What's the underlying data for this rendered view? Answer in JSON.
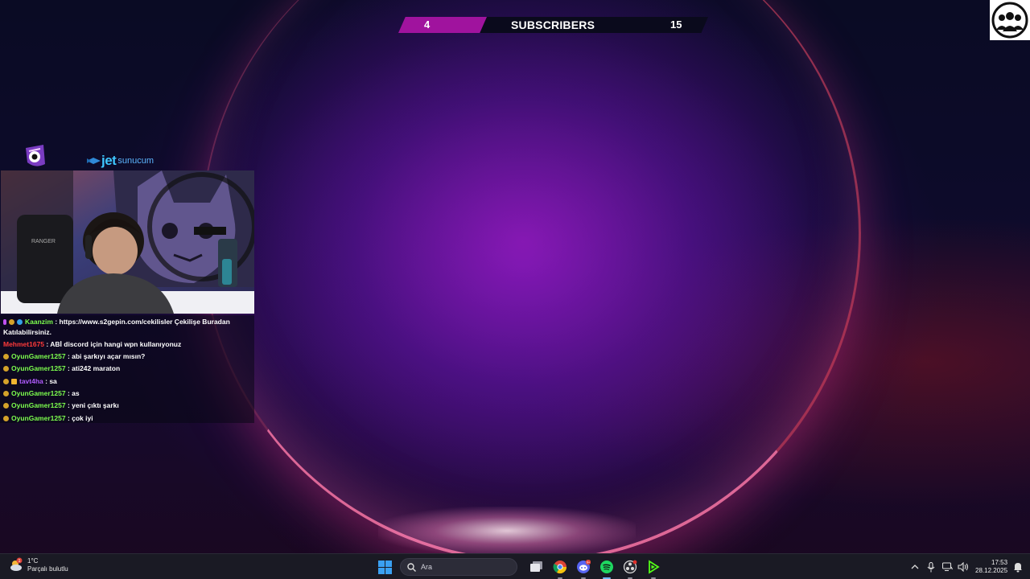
{
  "subscriber_bar": {
    "left_count": "4",
    "title": "SUBSCRIBERS",
    "right_count": "15"
  },
  "overlay": {
    "brand_jet": "jet",
    "brand_sub": "sunucum"
  },
  "chat": {
    "lines": [
      {
        "user": "Kaanzim",
        "sep": " : ",
        "msg": "https://www.s2gepin.com/cekilisler Çekilişe Buradan Katılabilirsiniz."
      },
      {
        "user": "Mehmet1675",
        "sep": " : ",
        "msg": "ABİ discord için hangi wpn kullanıyonuz"
      },
      {
        "user": "OyunGamer1257",
        "sep": " : ",
        "msg": "abi şarkıyı açar mısın?"
      },
      {
        "user": "OyunGamer1257",
        "sep": " : ",
        "msg": "ati242 maraton"
      },
      {
        "user": "tavt4ha",
        "sep": " : ",
        "msg": "sa"
      },
      {
        "user": "OyunGamer1257",
        "sep": " : ",
        "msg": "as"
      },
      {
        "user": "OyunGamer1257",
        "sep": " : ",
        "msg": "yeni çıktı şarkı"
      },
      {
        "user": "OyunGamer1257",
        "sep": " : ",
        "msg": "çok iyi"
      }
    ]
  },
  "taskbar": {
    "weather_temp": "1°C",
    "weather_desc": "Parçalı bulutlu",
    "weather_badge": "1",
    "search_placeholder": "Ara",
    "discord_badge": "9+",
    "clock_time": "17:53",
    "clock_date": "28.12.2025"
  },
  "icons": {
    "start": "windows-start-icon",
    "search": "search-icon",
    "task_view": "task-view-icon",
    "chrome": "chrome-icon",
    "discord": "discord-icon",
    "spotify": "spotify-icon",
    "obs": "obs-icon",
    "streamlabs": "streamlabs-icon",
    "tray": [
      "chevron-up-icon",
      "microphone-icon",
      "network-icon",
      "volume-icon",
      "notification-icon"
    ]
  },
  "colors": {
    "accent_magenta": "#a0139e",
    "chat_green": "#7dff4e",
    "chat_red": "#ff3a3a",
    "chat_purple": "#b05cff",
    "spotify_green": "#1ed760"
  }
}
